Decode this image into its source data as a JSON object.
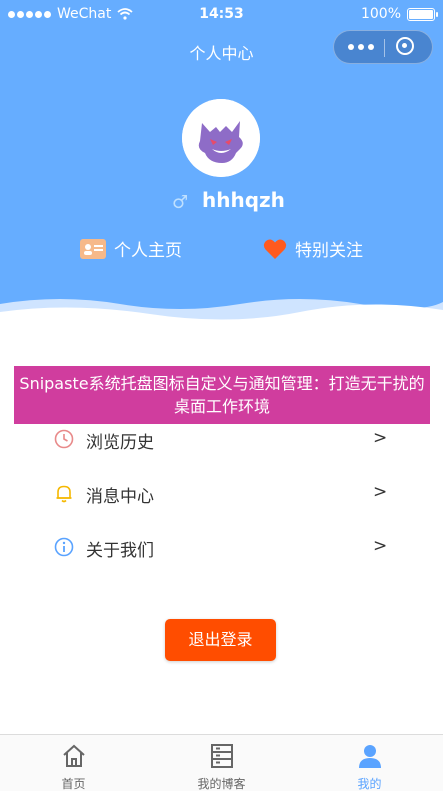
{
  "status_bar": {
    "carrier": "WeChat",
    "time": "14:53",
    "battery": "100%"
  },
  "nav": {
    "title": "个人中心"
  },
  "profile": {
    "gender_symbol": "♂",
    "username": "hhhqzh"
  },
  "links": [
    {
      "label": "个人主页",
      "icon": "id-card-icon"
    },
    {
      "label": "特别关注",
      "icon": "heart-icon"
    }
  ],
  "overlay_banner": {
    "text": "Snipaste系统托盘图标自定义与通知管理：打造无干扰的桌面工作环境"
  },
  "menu": [
    {
      "label": "浏览历史",
      "arrow": ">",
      "icon": "clock-icon",
      "icon_color": "#e88a8a"
    },
    {
      "label": "消息中心",
      "arrow": ">",
      "icon": "bell-icon",
      "icon_color": "#f5b800"
    },
    {
      "label": "关于我们",
      "arrow": ">",
      "icon": "info-icon",
      "icon_color": "#5aa3ff"
    }
  ],
  "logout": {
    "label": "退出登录",
    "color": "#ff4d00"
  },
  "tabs": [
    {
      "label": "首页",
      "icon": "home-icon",
      "active": false
    },
    {
      "label": "我的博客",
      "icon": "blog-list-icon",
      "active": false
    },
    {
      "label": "我的",
      "icon": "user-icon",
      "active": true
    }
  ],
  "colors": {
    "header_bg": "#66adff",
    "active_tab": "#5aa3ff",
    "banner_bg": "#d03d9e"
  }
}
